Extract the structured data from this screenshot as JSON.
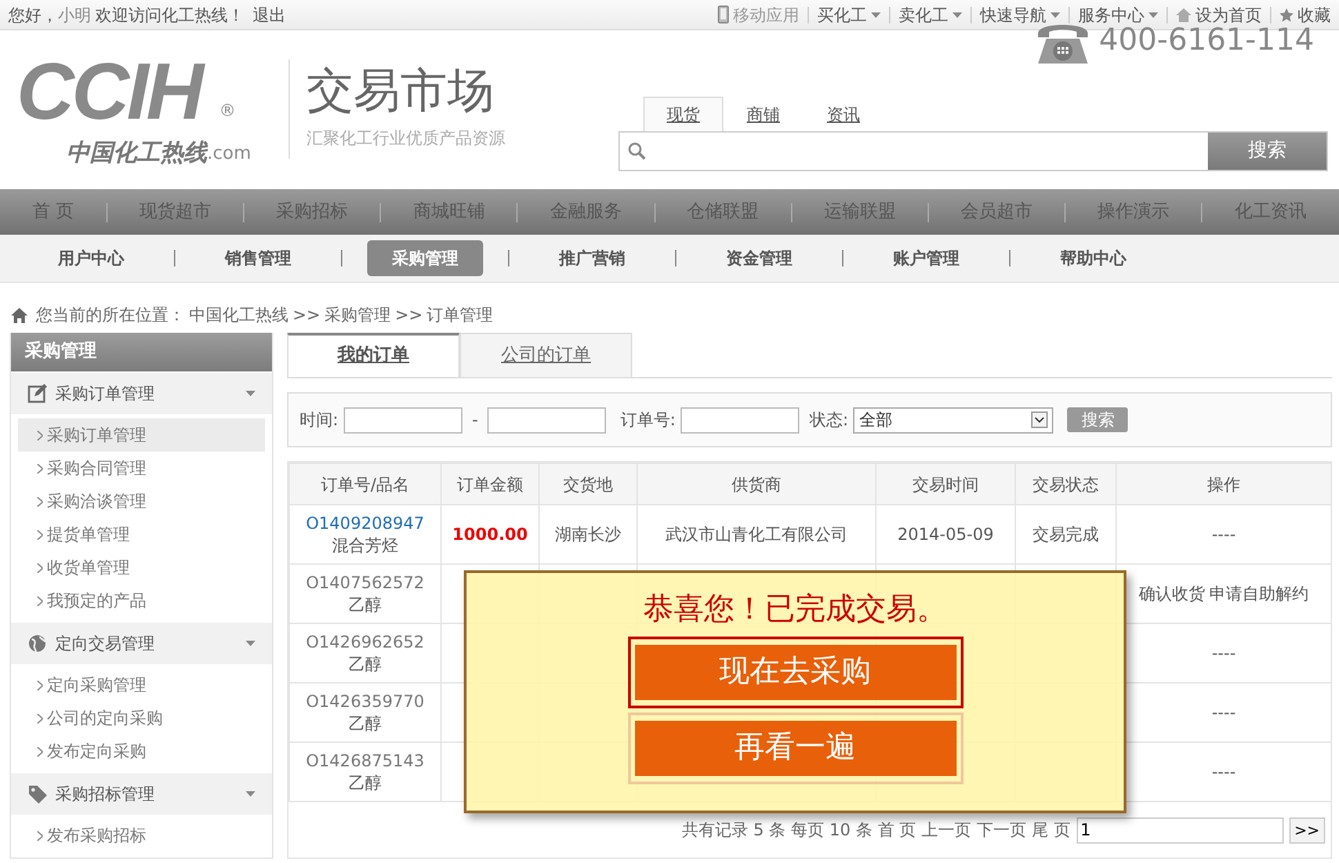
{
  "top_bar": {
    "greeting": "您好，",
    "user": "小明",
    "welcome": "欢迎访问化工热线！",
    "logout": "退出",
    "links": [
      {
        "label": "移动应用",
        "kind": "mobile"
      },
      {
        "label": "买化工",
        "kind": "dropdown"
      },
      {
        "label": "卖化工",
        "kind": "dropdown"
      },
      {
        "label": "快速导航",
        "kind": "dropdown"
      },
      {
        "label": "服务中心",
        "kind": "dropdown"
      },
      {
        "label": "设为首页",
        "kind": "home"
      },
      {
        "label": "收藏",
        "kind": "star"
      }
    ]
  },
  "header": {
    "logo": {
      "mark": "CCIH",
      "reg": "®",
      "name": "中国化工热线",
      "suffix": ".com"
    },
    "title": "交易市场",
    "subtitle": "汇聚化工行业优质产品资源",
    "search": {
      "tabs": [
        {
          "label": "现货",
          "selected": true
        },
        {
          "label": "商铺",
          "selected": false
        },
        {
          "label": "资讯",
          "selected": false
        }
      ],
      "button": "搜索"
    },
    "phone": "400-6161-114"
  },
  "main_nav": [
    "首 页",
    "现货超市",
    "采购招标",
    "商城旺铺",
    "金融服务",
    "仓储联盟",
    "运输联盟",
    "会员超市",
    "操作演示",
    "化工资讯"
  ],
  "sub_nav": [
    {
      "label": "用户中心",
      "selected": false
    },
    {
      "label": "销售管理",
      "selected": false
    },
    {
      "label": "采购管理",
      "selected": true
    },
    {
      "label": "推广营销",
      "selected": false
    },
    {
      "label": "资金管理",
      "selected": false
    },
    {
      "label": "账户管理",
      "selected": false
    },
    {
      "label": "帮助中心",
      "selected": false
    }
  ],
  "breadcrumb": {
    "prefix": "您当前的所在位置：",
    "separator": ">>",
    "items": [
      "中国化工热线",
      "采购管理",
      "订单管理"
    ]
  },
  "sidebar": {
    "title": "采购管理",
    "groups": [
      {
        "title": "采购订单管理",
        "kind": "edit",
        "items": [
          {
            "label": "采购订单管理",
            "selected": true
          },
          {
            "label": "采购合同管理",
            "selected": false
          },
          {
            "label": "采购洽谈管理",
            "selected": false
          },
          {
            "label": "提货单管理",
            "selected": false
          },
          {
            "label": "收货单管理",
            "selected": false
          },
          {
            "label": "我预定的产品",
            "selected": false
          }
        ]
      },
      {
        "title": "定向交易管理",
        "kind": "globe",
        "items": [
          {
            "label": "定向采购管理",
            "selected": false
          },
          {
            "label": "公司的定向采购",
            "selected": false
          },
          {
            "label": "发布定向采购",
            "selected": false
          }
        ]
      },
      {
        "title": "采购招标管理",
        "kind": "tag",
        "items": [
          {
            "label": "发布采购招标",
            "selected": false
          }
        ]
      }
    ]
  },
  "tabs": [
    {
      "label": "我的订单",
      "selected": true
    },
    {
      "label": "公司的订单",
      "selected": false
    }
  ],
  "filter": {
    "time_label": "时间:",
    "dash": "-",
    "order_label": "订单号:",
    "status_label": "状态:",
    "status_value": "全部",
    "button": "搜索"
  },
  "table": {
    "columns": [
      "订单号/品名",
      "订单金额",
      "交货地",
      "供货商",
      "交易时间",
      "交易状态",
      "操作"
    ],
    "rows": [
      {
        "selected": true,
        "order_no": "O1409208947",
        "product": "混合芳烃",
        "amount": "1000.00",
        "place": "湖南长沙",
        "supplier": "武汉市山青化工有限公司",
        "date": "2014-05-09",
        "status": "交易完成",
        "actions": [
          "----"
        ]
      },
      {
        "selected": false,
        "order_no": "O1407562572",
        "product": "乙醇",
        "actions": [
          "确认收货",
          "申请自助解约"
        ]
      },
      {
        "selected": false,
        "order_no": "O1426962652",
        "product": "乙醇",
        "actions": [
          "----"
        ]
      },
      {
        "selected": false,
        "order_no": "O1426359770",
        "product": "乙醇",
        "actions": [
          "----"
        ]
      },
      {
        "selected": false,
        "order_no": "O1426875143",
        "product": "乙醇",
        "actions": [
          "----"
        ]
      }
    ]
  },
  "pager": {
    "summary": "共有记录 5 条 每页 10 条",
    "links": [
      "首 页",
      "上一页",
      "下一页",
      "尾 页"
    ],
    "page": "1",
    "go": ">>"
  },
  "popup": {
    "title": "恭喜您！已完成交易。",
    "buttons": [
      {
        "label": "现在去采购",
        "focused": true
      },
      {
        "label": "再看一遍",
        "focused": false
      }
    ]
  }
}
